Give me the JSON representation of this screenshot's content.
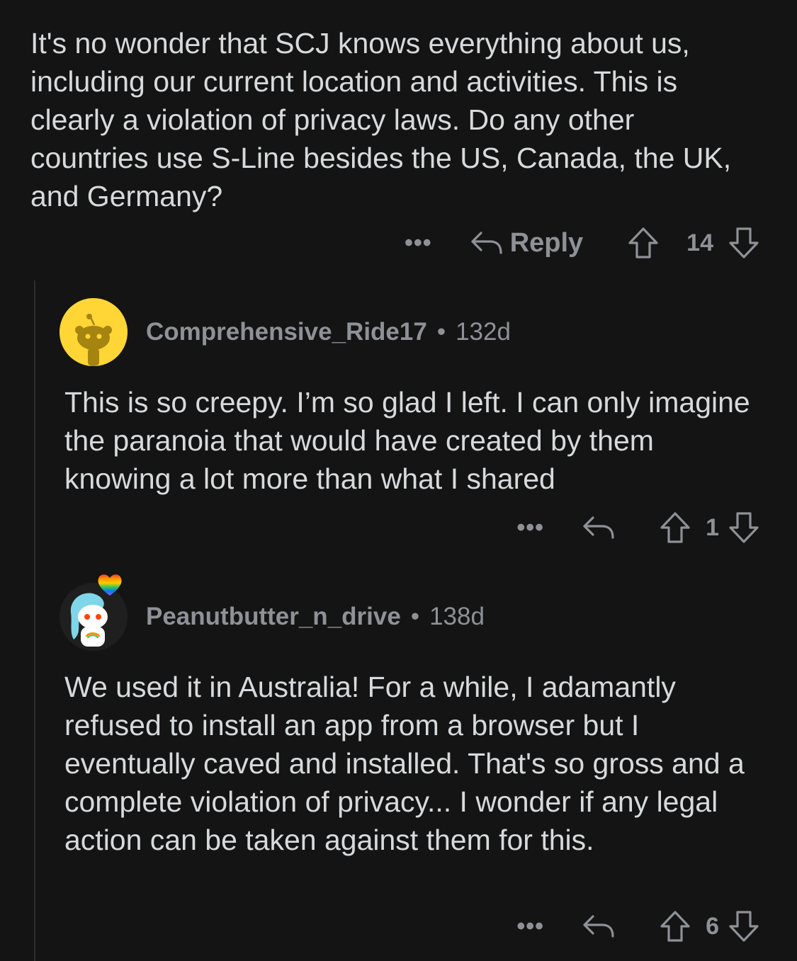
{
  "parent_comment": {
    "body": "It's no wonder that SCJ knows everything about us, including our current location and activities. This is clearly a violation of privacy laws. Do any other countries use S-Line besides the US, Canada, the UK, and Germany?",
    "more_label": "•••",
    "reply_label": "Reply",
    "score": "14"
  },
  "replies": [
    {
      "username": "Comprehensive_Ride17",
      "separator": "•",
      "age": "132d",
      "body": "This is so creepy. I’m so glad I left. I can only imagine the paranoia that would have created by them knowing a lot more than what I shared",
      "more_label": "•••",
      "score": "1",
      "avatar_color": "#ffd635"
    },
    {
      "username": "Peanutbutter_n_drive",
      "separator": "•",
      "age": "138d",
      "body": "We used it in Australia! For a while, I adamantly refused to install an app from a browser but I eventually caved and installed. That's so gross and a complete violation of privacy... I wonder if any legal action can be taken against them for this.",
      "more_label": "•••",
      "score": "6",
      "avatar_color": "#1f1f1f"
    }
  ],
  "colors": {
    "background": "#141414",
    "text": "#d7dadc",
    "meta": "#8e9196",
    "thread_line": "#2d2d2f"
  },
  "icons": {
    "reply": "reply-arrow-icon",
    "upvote": "upvote-arrow-icon",
    "downvote": "downvote-arrow-icon",
    "more": "more-dots-icon"
  }
}
